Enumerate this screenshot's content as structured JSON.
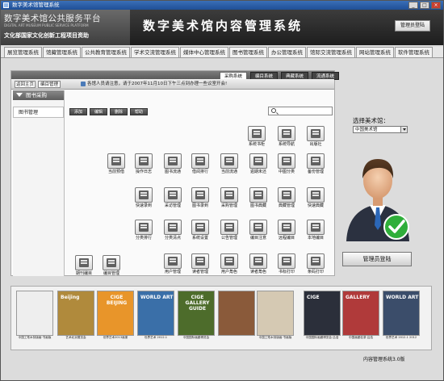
{
  "window": {
    "title": "数字美术馆管理系统"
  },
  "header": {
    "logo_cn": "数字美术馆公共服务平台",
    "logo_en": "DIGITAL ART MUSEUM PUBLIC SERVICE PLATFORM",
    "logo_sub": "文化部国家文化创新工程项目资助",
    "title": "数字美术馆内容管理系统",
    "admin_login": "管理员登陆"
  },
  "nav": [
    "展览管理系统",
    "馆藏管理系统",
    "公共教育管理系统",
    "学术交流管理系统",
    "媒体中心管理系统",
    "图书管理系统",
    "办公管理系统",
    "馆际交流管理系统",
    "网站管理系统",
    "软件管理系统"
  ],
  "content": {
    "top_tabs": [
      "采购系统",
      "编目系统",
      "典藏系统",
      "流通系统"
    ],
    "btn_return": "返回主页",
    "btn_catalog": "编目管理",
    "notice": "各馆人员请注意，请于2007年11月10日下午三点到办理一些议室开会!",
    "side_header": "图书采购",
    "side_item": "图书管理",
    "toolbar": [
      "添加",
      "编辑",
      "删除",
      "帮助"
    ],
    "icons": [
      {
        "label": "系统书柜"
      },
      {
        "label": "系统导航"
      },
      {
        "label": "出版社"
      },
      {
        "label": "当前预借"
      },
      {
        "label": "操作日志"
      },
      {
        "label": "图书流通"
      },
      {
        "label": "借阅排行"
      },
      {
        "label": "当前流通"
      },
      {
        "label": "逾期未还"
      },
      {
        "label": "中图分类"
      },
      {
        "label": "备份管理"
      },
      {
        "label": "快速录到"
      },
      {
        "label": "采访管理"
      },
      {
        "label": "图书录到"
      },
      {
        "label": "采购管理"
      },
      {
        "label": "图书典藏"
      },
      {
        "label": "典藏管理"
      },
      {
        "label": "快速典藏"
      },
      {
        "label": "分类排行"
      },
      {
        "label": "分类清点"
      },
      {
        "label": "系统设置"
      },
      {
        "label": "公告管理"
      },
      {
        "label": "编目注意"
      },
      {
        "label": "远程编目"
      },
      {
        "label": "本地编目"
      },
      {
        "label": "期刊编目"
      },
      {
        "label": "编目管理"
      },
      {
        "label": "用户管理"
      },
      {
        "label": "读者管理"
      },
      {
        "label": "用户角色"
      },
      {
        "label": "读者角色"
      },
      {
        "label": "书标打印"
      },
      {
        "label": "条码打印"
      }
    ]
  },
  "right": {
    "select_label": "选择美术馆：",
    "select_value": "中国美术馆",
    "login_button": "管理员登陆",
    "colors": {
      "badge": "#2fae3a",
      "suit": "#2b3140",
      "tie": "#2b67b8"
    }
  },
  "thumbs": [
    {
      "caption": "中国工笔木刻版画·书画版",
      "bg": "#eeeeee"
    },
    {
      "caption": "艺术北京展览会",
      "bg": "#b08a3c",
      "title": "Beijing"
    },
    {
      "caption": "世界艺术2013画册",
      "bg": "#e8952a",
      "title": "CIGE BEIJING"
    },
    {
      "caption": "世界艺术 2012.1",
      "bg": "#3a6fa8",
      "title": "WORLD ART"
    },
    {
      "caption": "中国国际画廊博览会",
      "bg": "#4d6c2b",
      "title": "CIGE GALLERY GUIDE"
    },
    {
      "caption": "",
      "bg": "#8a5a3a"
    },
    {
      "caption": "中国工笔木刻版画·书画版",
      "bg": "#d5c9b3"
    },
    {
      "caption": "中国国际画廊博览会·吕浩",
      "bg": "#2b2f3a",
      "title": "CIGE"
    },
    {
      "caption": "中国画廊名录·吕浩",
      "bg": "#b03a3a",
      "title": "GALLERY"
    },
    {
      "caption": "世界艺术 2012.1 2012",
      "bg": "#3b4d6a",
      "title": "WORLD ART"
    }
  ],
  "footer": "内容管理系统3.0版"
}
